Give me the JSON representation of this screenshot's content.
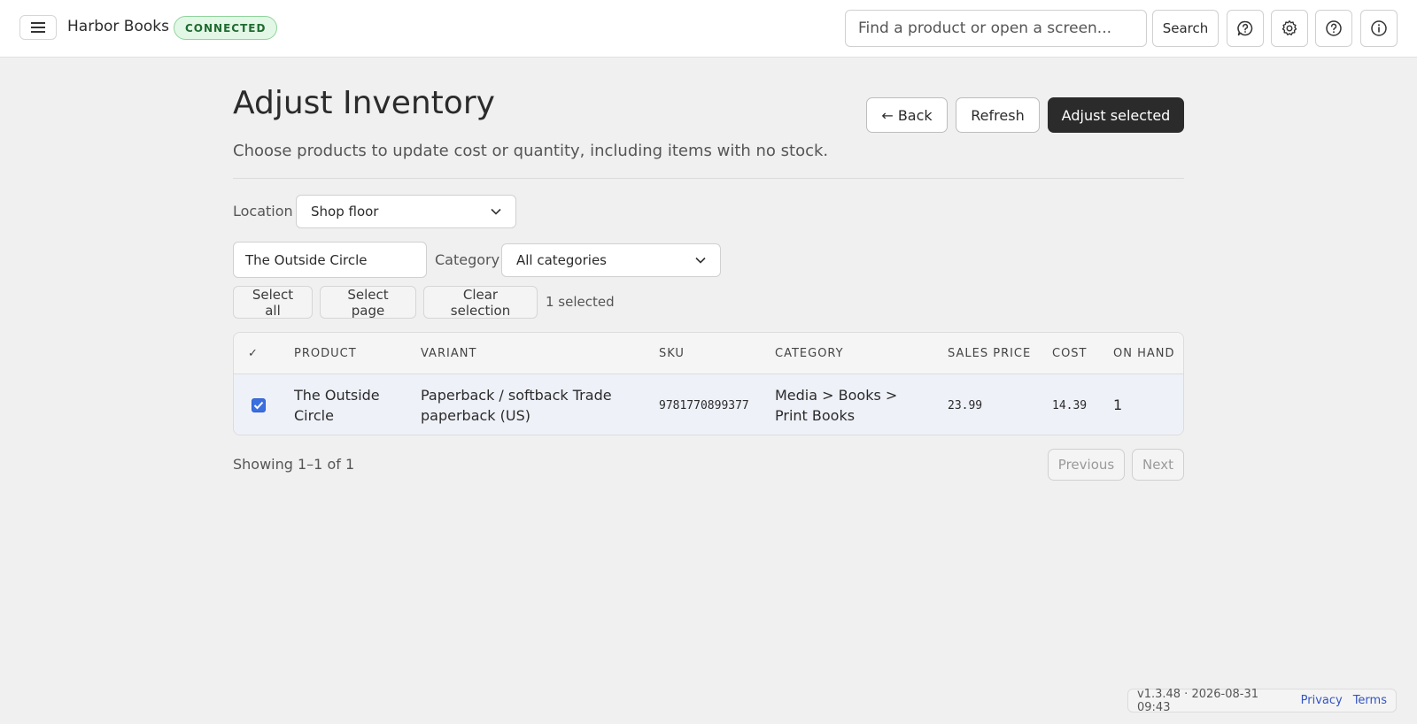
{
  "header": {
    "app_name": "Harbor Books",
    "status": "CONNECTED",
    "search_placeholder": "Find a product or open a screen...",
    "search_label": "Search",
    "icons": [
      "menu-icon",
      "feedback-icon",
      "gear-icon",
      "help-icon",
      "info-icon"
    ]
  },
  "page": {
    "title": "Adjust Inventory",
    "subtitle": "Choose products to update cost or quantity, including items with no stock.",
    "back_label": "← Back",
    "refresh_label": "Refresh",
    "adjust_label": "Adjust selected"
  },
  "filters": {
    "location_label": "Location",
    "location_value": "Shop floor",
    "search_value": "The Outside Circle",
    "category_label": "Category",
    "category_value": "All categories"
  },
  "selection": {
    "select_all": "Select all",
    "select_page": "Select page",
    "clear": "Clear selection",
    "count_text": "1 selected"
  },
  "table": {
    "columns": [
      "✓",
      "PRODUCT",
      "VARIANT",
      "SKU",
      "CATEGORY",
      "SALES PRICE",
      "COST",
      "ON HAND"
    ],
    "rows": [
      {
        "checked": true,
        "product": "The Outside Circle",
        "variant": "Paperback / softback Trade paperback (US)",
        "sku": "9781770899377",
        "category": "Media > Books > Print Books",
        "sales_price": "23.99",
        "cost": "14.39",
        "on_hand": "1"
      }
    ]
  },
  "pagination": {
    "showing": "Showing 1–1 of 1",
    "previous": "Previous",
    "next": "Next"
  },
  "footer": {
    "version": "v1.3.48 · 2026-08-31 09:43",
    "privacy": "Privacy",
    "terms": "Terms"
  },
  "colors": {
    "accent": "#3b6fe0",
    "dark_button": "#2b2b2b",
    "status_bg": "#e3f7e6",
    "selected_row": "#eef1f8"
  }
}
